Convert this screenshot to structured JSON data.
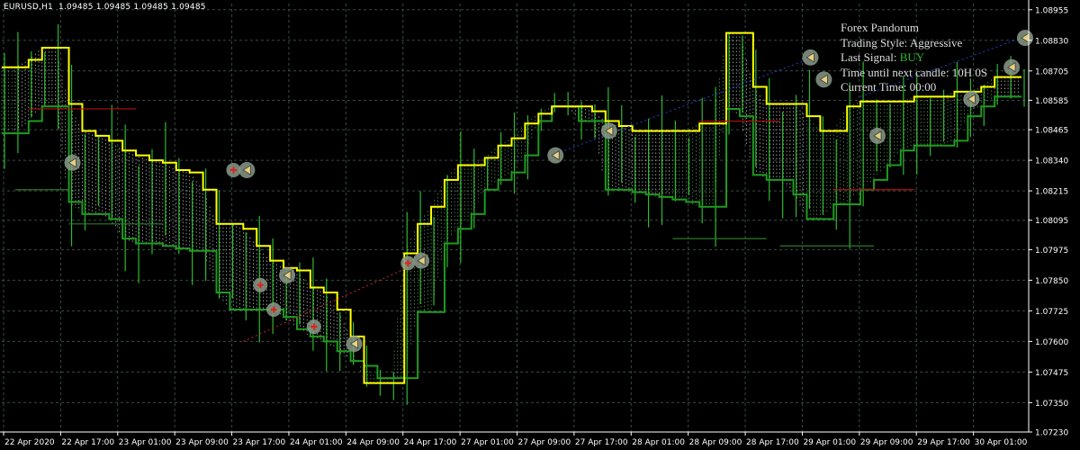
{
  "header": {
    "symbol": "EURUSD,H1",
    "ohlc": "1.09485 1.09485 1.09485 1.09485"
  },
  "info_panel": {
    "title": "Forex Pandorum",
    "trading_style_label": "Trading Style:",
    "trading_style_value": "Aggressive",
    "last_signal_label": "Last Signal:",
    "last_signal_value": "BUY",
    "time_until_label": "Time until next candle:",
    "time_until_value": "10H 0S",
    "current_time_label": "Current Time:",
    "current_time_value": "00:00"
  },
  "colors": {
    "background": "#000000",
    "grid": "#3a4a46",
    "axis_text": "#ffffff",
    "upper_band": "#ffff00",
    "lower_band": "#1f9a1f",
    "candles": "#2fb82f",
    "buy_marker": "#3cc93c",
    "sell_marker": "#e02020"
  },
  "chart_data": {
    "type": "line",
    "price_axis_ticks": [
      "1.08955",
      "1.08830",
      "1.08705",
      "1.08585",
      "1.08465",
      "1.08340",
      "1.08215",
      "1.08095",
      "1.07975",
      "1.07850",
      "1.07725",
      "1.07600",
      "1.07475",
      "1.07350",
      "1.07230"
    ],
    "time_axis_ticks": [
      "22 Apr 2020",
      "22 Apr 17:00",
      "23 Apr 01:00",
      "23 Apr 09:00",
      "23 Apr 17:00",
      "24 Apr 01:00",
      "24 Apr 09:00",
      "24 Apr 17:00",
      "27 Apr 01:00",
      "27 Apr 09:00",
      "27 Apr 17:00",
      "28 Apr 01:00",
      "28 Apr 09:00",
      "28 Apr 17:00",
      "29 Apr 01:00",
      "29 Apr 09:00",
      "29 Apr 17:00",
      "30 Apr 01:00"
    ],
    "ylim": [
      1.0723,
      1.0898
    ],
    "grid": true,
    "series": [
      {
        "key": "upper",
        "values": [
          1.0872,
          1.0872,
          1.0875,
          1.088,
          1.088,
          1.0857,
          1.0846,
          1.0844,
          1.0842,
          1.0838,
          1.0836,
          1.0834,
          1.0833,
          1.083,
          1.0829,
          1.0822,
          1.0808,
          1.0808,
          1.0806,
          1.0799,
          1.0793,
          1.079,
          1.0789,
          1.0782,
          1.078,
          1.0773,
          1.0762,
          1.0743,
          1.0743,
          1.0743,
          1.0796,
          1.0808,
          1.0815,
          1.0826,
          1.0832,
          1.0832,
          1.0835,
          1.084,
          1.0843,
          1.0849,
          1.0853,
          1.0856,
          1.0856,
          1.0856,
          1.0854,
          1.085,
          1.0848,
          1.0846,
          1.0846,
          1.0846,
          1.0846,
          1.0846,
          1.0849,
          1.0849,
          1.0886,
          1.0886,
          1.0864,
          1.0857,
          1.0857,
          1.0857,
          1.0852,
          1.0846,
          1.0846,
          1.0856,
          1.0858,
          1.0858,
          1.0858,
          1.0858,
          1.086,
          1.086,
          1.086,
          1.0862,
          1.0862,
          1.0864,
          1.0868,
          1.0868,
          1.0868
        ]
      },
      {
        "key": "lower",
        "values": [
          1.0845,
          1.0845,
          1.085,
          1.0856,
          1.0856,
          1.0817,
          1.0812,
          1.0812,
          1.081,
          1.0802,
          1.08,
          1.08,
          1.0799,
          1.0798,
          1.0797,
          1.0797,
          1.078,
          1.0773,
          1.0773,
          1.0773,
          1.0773,
          1.077,
          1.0765,
          1.0762,
          1.076,
          1.0756,
          1.0752,
          1.075,
          1.0745,
          1.0745,
          1.0745,
          1.0772,
          1.0772,
          1.08,
          1.0806,
          1.0812,
          1.0822,
          1.0826,
          1.0829,
          1.0836,
          1.085,
          1.0856,
          1.0856,
          1.085,
          1.085,
          1.0822,
          1.0822,
          1.0821,
          1.082,
          1.0819,
          1.0818,
          1.0817,
          1.0815,
          1.0815,
          1.0855,
          1.0852,
          1.0828,
          1.0826,
          1.0826,
          1.082,
          1.081,
          1.081,
          1.0816,
          1.0816,
          1.0822,
          1.0826,
          1.0832,
          1.0838,
          1.084,
          1.084,
          1.084,
          1.0842,
          1.0852,
          1.0856,
          1.086,
          1.086,
          1.086
        ]
      }
    ],
    "annotations": {
      "buy_arrows": [
        [
          5,
          1.0833
        ],
        [
          18,
          1.083
        ],
        [
          21,
          1.0787
        ],
        [
          26,
          1.0759
        ],
        [
          31,
          1.0793
        ],
        [
          41,
          1.0836
        ],
        [
          45,
          1.0846
        ],
        [
          60,
          1.0876
        ],
        [
          61,
          1.0867
        ],
        [
          65,
          1.0844
        ],
        [
          72,
          1.0859
        ],
        [
          75,
          1.0872
        ],
        [
          76,
          1.0884
        ]
      ],
      "sell_crosses": [
        [
          17,
          1.083
        ],
        [
          19,
          1.0783
        ],
        [
          20,
          1.0773
        ],
        [
          23,
          1.0766
        ],
        [
          30,
          1.0792
        ]
      ]
    }
  }
}
